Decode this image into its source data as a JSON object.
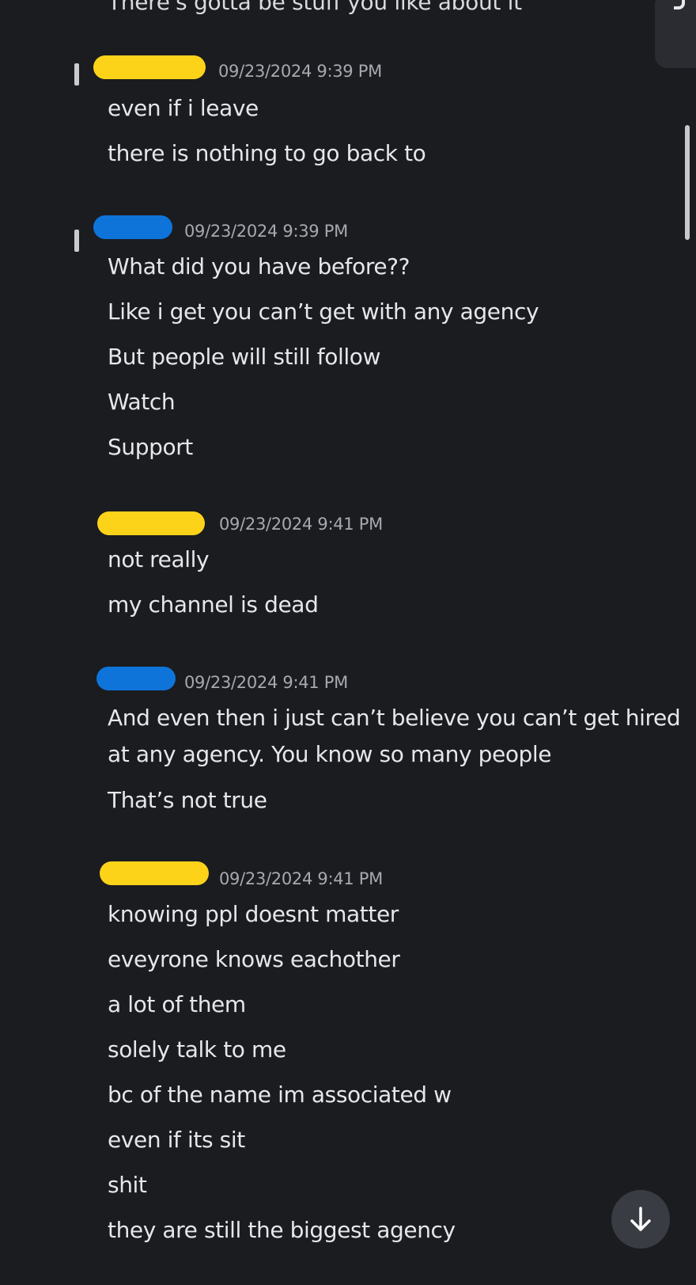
{
  "previous_message_tail": "There's gotta be stuff you like about it",
  "colors": {
    "background": "#1b1c20",
    "user_a_redaction": "#fdd31a",
    "user_b_redaction": "#0e74d9",
    "timestamp": "#a7a9b0",
    "text": "#e6e7ea"
  },
  "messages": [
    {
      "author_redaction": "yellow",
      "timestamp": "09/23/2024 9:39 PM",
      "lines": [
        "even if i leave",
        "there is nothing to go back to"
      ]
    },
    {
      "author_redaction": "blue",
      "timestamp": "09/23/2024 9:39 PM",
      "lines": [
        "What did you have before??",
        "Like i get you can’t get with any agency",
        "But people will still follow",
        "Watch",
        "Support"
      ]
    },
    {
      "author_redaction": "yellow",
      "timestamp": "09/23/2024 9:41 PM",
      "lines": [
        "not really",
        "my channel is dead"
      ]
    },
    {
      "author_redaction": "blue",
      "timestamp": "09/23/2024 9:41 PM",
      "lines": [
        "And even then i just can’t believe you can’t get hired",
        "at any agency. You know so many people",
        "That’s not true"
      ]
    },
    {
      "author_redaction": "yellow",
      "timestamp": "09/23/2024 9:41 PM",
      "lines": [
        "knowing ppl doesnt matter",
        "eveyrone knows eachother",
        "a lot of them",
        "solely talk to me",
        "bc of the name im associated w",
        "even if its sit",
        "shit",
        "they are still the biggest agency"
      ]
    }
  ],
  "scroll_down_button": {
    "icon": "arrow-down-icon"
  }
}
